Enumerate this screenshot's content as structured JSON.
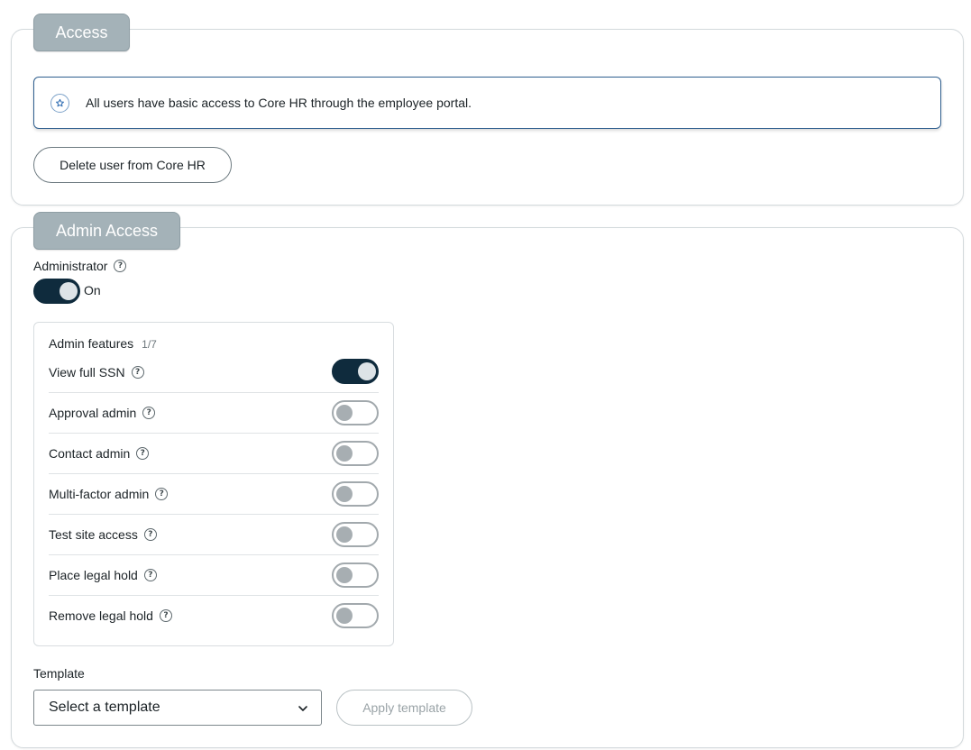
{
  "access": {
    "tab_label": "Access",
    "info_text": "All users have basic access to Core HR through the employee portal.",
    "info_icon": "star-badge-icon",
    "delete_button": "Delete user from Core HR"
  },
  "admin": {
    "tab_label": "Admin Access",
    "administrator_label": "Administrator",
    "administrator_state": "On",
    "administrator_on": true,
    "features": {
      "title": "Admin features",
      "count": "1/7",
      "items": [
        {
          "label": "View full SSN",
          "on": true
        },
        {
          "label": "Approval admin",
          "on": false
        },
        {
          "label": "Contact admin",
          "on": false
        },
        {
          "label": "Multi-factor admin",
          "on": false
        },
        {
          "label": "Test site access",
          "on": false
        },
        {
          "label": "Place legal hold",
          "on": false
        },
        {
          "label": "Remove legal hold",
          "on": false
        }
      ]
    },
    "template_label": "Template",
    "template_placeholder": "Select a template",
    "apply_button": "Apply template"
  },
  "colors": {
    "tab_bg": "#a4b2b8",
    "toggle_on": "#0f2b3d",
    "info_border": "#2f5f8f"
  }
}
